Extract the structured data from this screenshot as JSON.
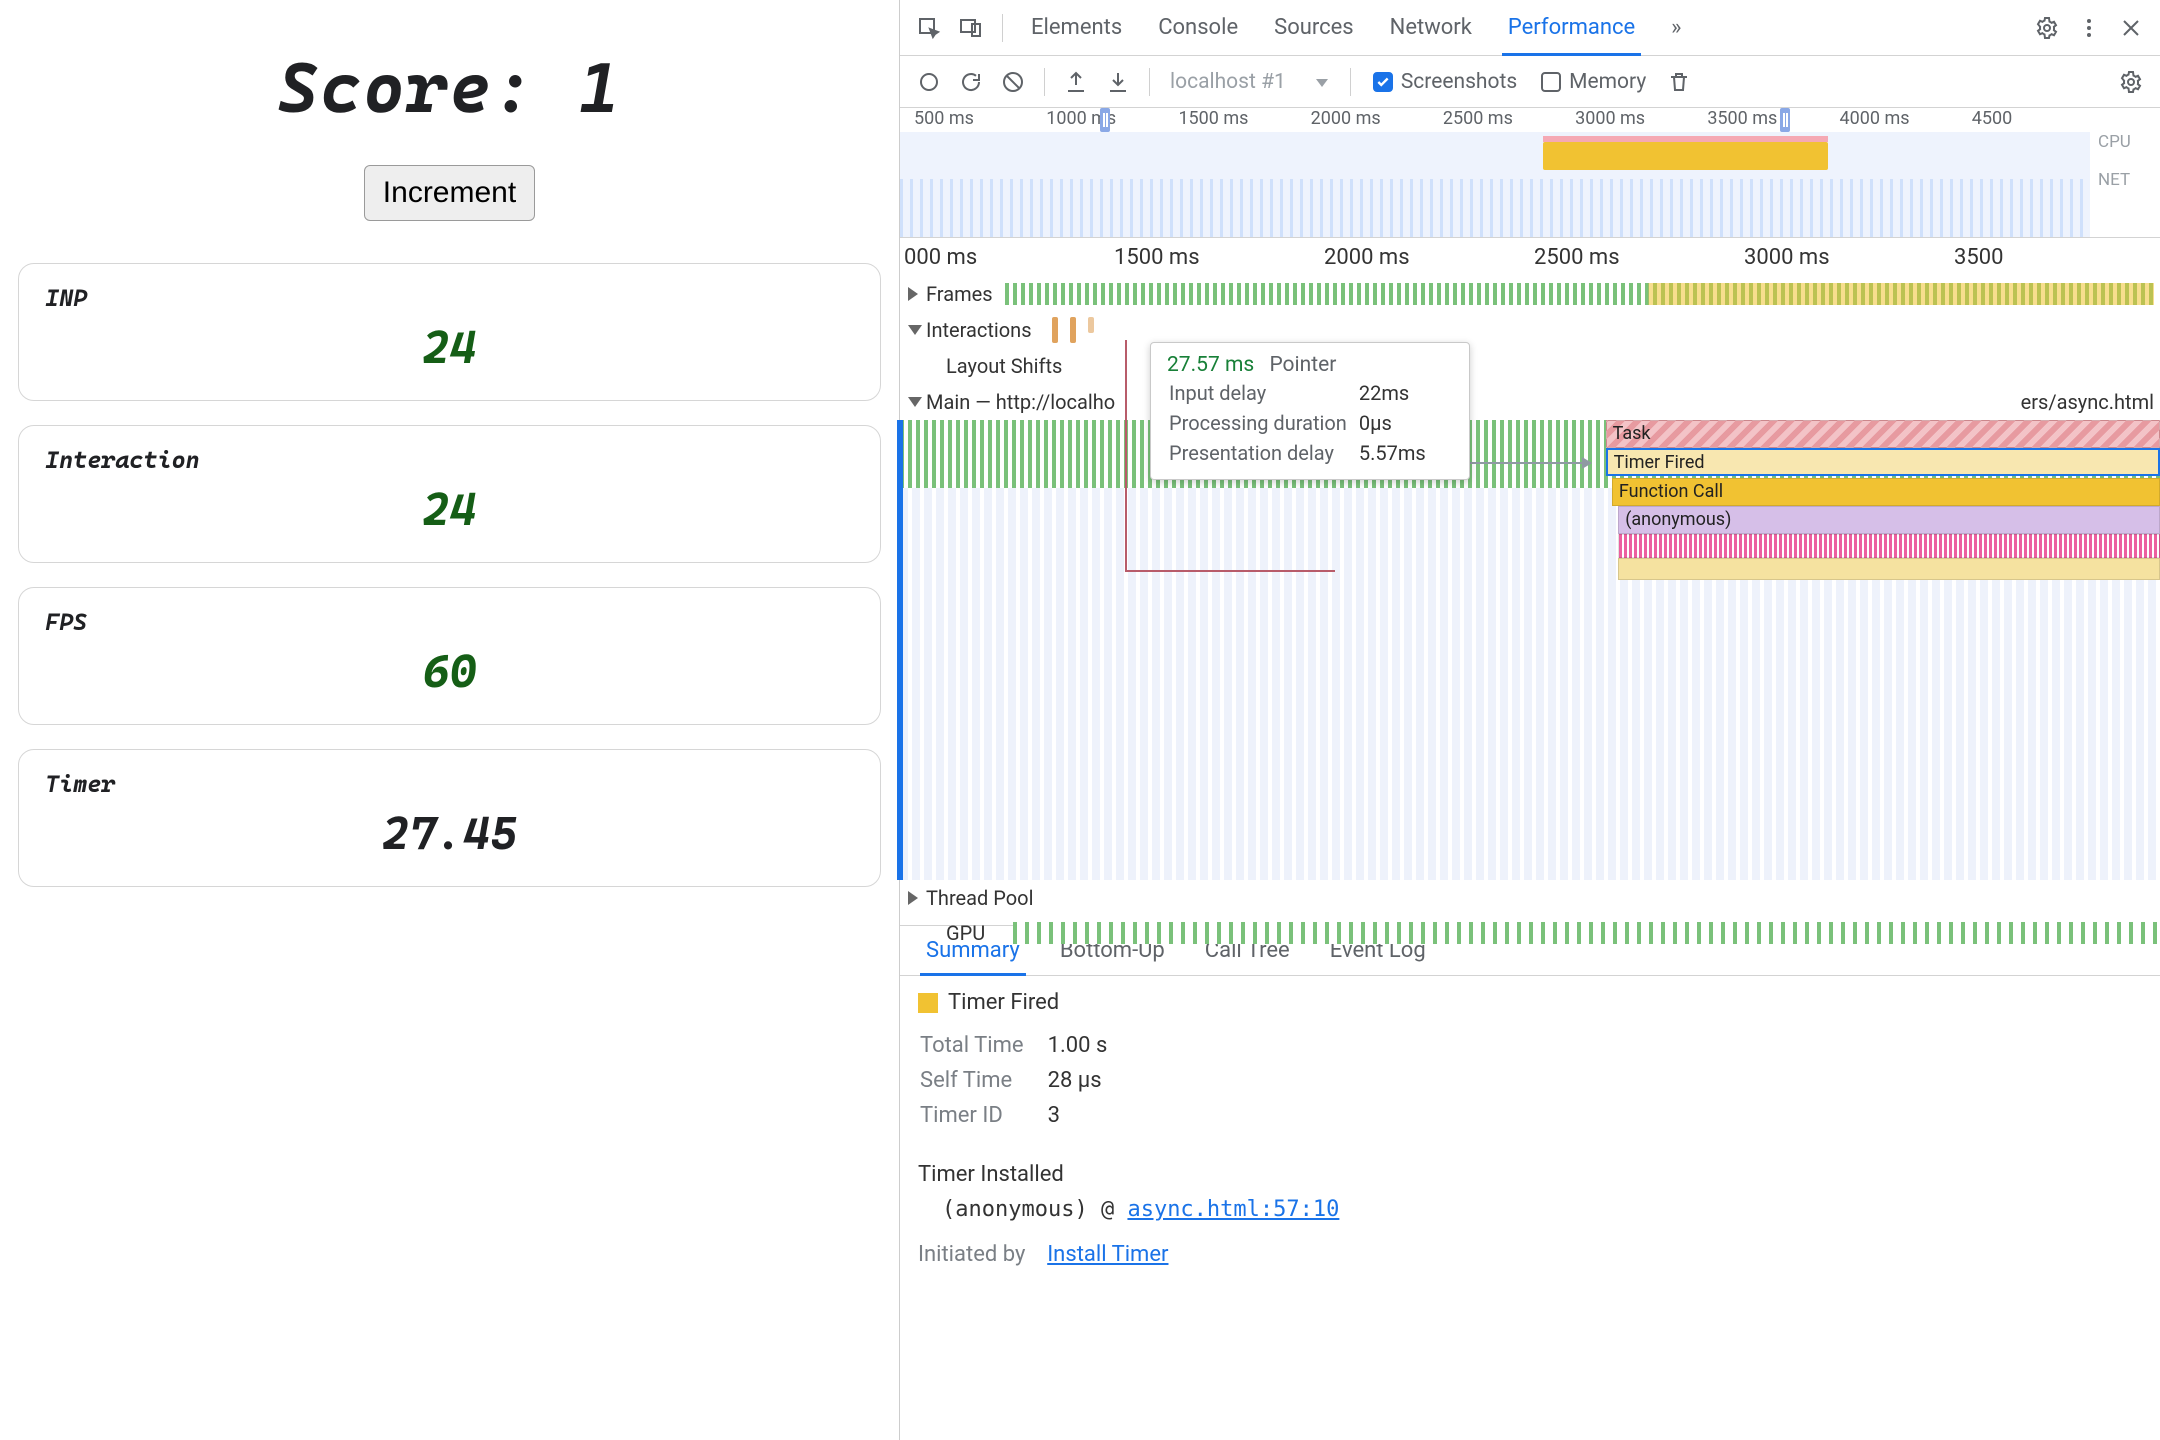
{
  "app": {
    "score_label": "Score:",
    "score_value": "1",
    "increment_label": "Increment",
    "cards": {
      "inp": {
        "label": "INP",
        "value": "24"
      },
      "interaction": {
        "label": "Interaction",
        "value": "24"
      },
      "fps": {
        "label": "FPS",
        "value": "60"
      },
      "timer": {
        "label": "Timer",
        "value": "27.45"
      }
    }
  },
  "devtools": {
    "tabs": {
      "elements": "Elements",
      "console": "Console",
      "sources": "Sources",
      "network": "Network",
      "performance": "Performance",
      "more": "»"
    },
    "toolbar": {
      "profile_name": "localhost #1",
      "screenshots": "Screenshots",
      "memory": "Memory"
    },
    "overview": {
      "ticks": [
        "500 ms",
        "1000 ms",
        "1500 ms",
        "2000 ms",
        "2500 ms",
        "3000 ms",
        "3500 ms",
        "4000 ms",
        "4500"
      ],
      "right_labels": [
        "CPU",
        "NET"
      ]
    },
    "flame": {
      "ruler": [
        "000 ms",
        "1500 ms",
        "2000 ms",
        "2500 ms",
        "3000 ms",
        "3500"
      ],
      "rows": {
        "frames": "Frames",
        "interactions": "Interactions",
        "layout_shifts": "Layout Shifts",
        "main": "Main — http://localho",
        "main_suffix": "ers/async.html",
        "thread_pool": "Thread Pool",
        "gpu": "GPU"
      },
      "blocks": {
        "task": "Task",
        "timer_fired": "Timer Fired",
        "function_call": "Function Call",
        "anonymous": "(anonymous)"
      }
    },
    "tooltip": {
      "ms": "27.57 ms",
      "kind": "Pointer",
      "rows": [
        {
          "k": "Input delay",
          "v": "22ms"
        },
        {
          "k": "Processing duration",
          "v": "0µs"
        },
        {
          "k": "Presentation delay",
          "v": "5.57ms"
        }
      ]
    },
    "summary": {
      "tabs": {
        "summary": "Summary",
        "bottom_up": "Bottom-Up",
        "call_tree": "Call Tree",
        "event_log": "Event Log"
      },
      "title": "Timer Fired",
      "rows": [
        {
          "k": "Total Time",
          "v": "1.00 s"
        },
        {
          "k": "Self Time",
          "v": "28 µs"
        },
        {
          "k": "Timer ID",
          "v": "3"
        }
      ],
      "installed_title": "Timer Installed",
      "installed_fn": "(anonymous)",
      "at": "@",
      "installed_link": "async.html:57:10",
      "initiated_by_label": "Initiated by",
      "initiated_by_link": "Install Timer"
    }
  }
}
